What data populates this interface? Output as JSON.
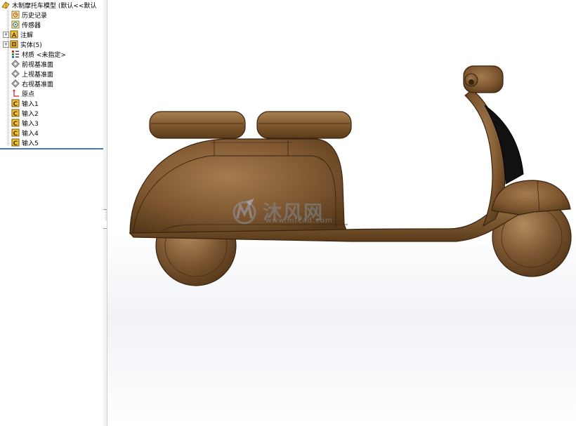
{
  "feature_tree": {
    "root_label": "木制摩托车模型 (默认<<默认",
    "items": [
      {
        "label": "历史记录",
        "icon": "history-icon",
        "expandable": false
      },
      {
        "label": "传感器",
        "icon": "sensor-icon",
        "expandable": false
      },
      {
        "label": "注解",
        "icon": "annotation-icon",
        "expandable": true
      },
      {
        "label": "实体(5)",
        "icon": "solid-bodies-icon",
        "expandable": true
      },
      {
        "label": "材质 <未指定>",
        "icon": "material-icon",
        "expandable": false
      },
      {
        "label": "前视基准面",
        "icon": "plane-icon",
        "expandable": false
      },
      {
        "label": "上视基准面",
        "icon": "plane-icon",
        "expandable": false
      },
      {
        "label": "右视基准面",
        "icon": "plane-icon",
        "expandable": false
      },
      {
        "label": "原点",
        "icon": "origin-icon",
        "expandable": false
      },
      {
        "label": "输入1",
        "icon": "imported-part-icon",
        "expandable": false
      },
      {
        "label": "输入2",
        "icon": "imported-part-icon",
        "expandable": false
      },
      {
        "label": "输入3",
        "icon": "imported-part-icon",
        "expandable": false
      },
      {
        "label": "输入4",
        "icon": "imported-part-icon",
        "expandable": false
      },
      {
        "label": "输入5",
        "icon": "imported-part-icon",
        "expandable": false
      }
    ]
  },
  "watermark": {
    "brand": "沐风网",
    "url": "www.mfcad.com"
  },
  "colors": {
    "wood_dark": "#5e3f20",
    "wood_mid": "#8a6238",
    "wood_light": "#b0885a",
    "grip_black": "#111111",
    "tree_separator": "#4a78b8",
    "folder_yellow": "#f2c230"
  }
}
